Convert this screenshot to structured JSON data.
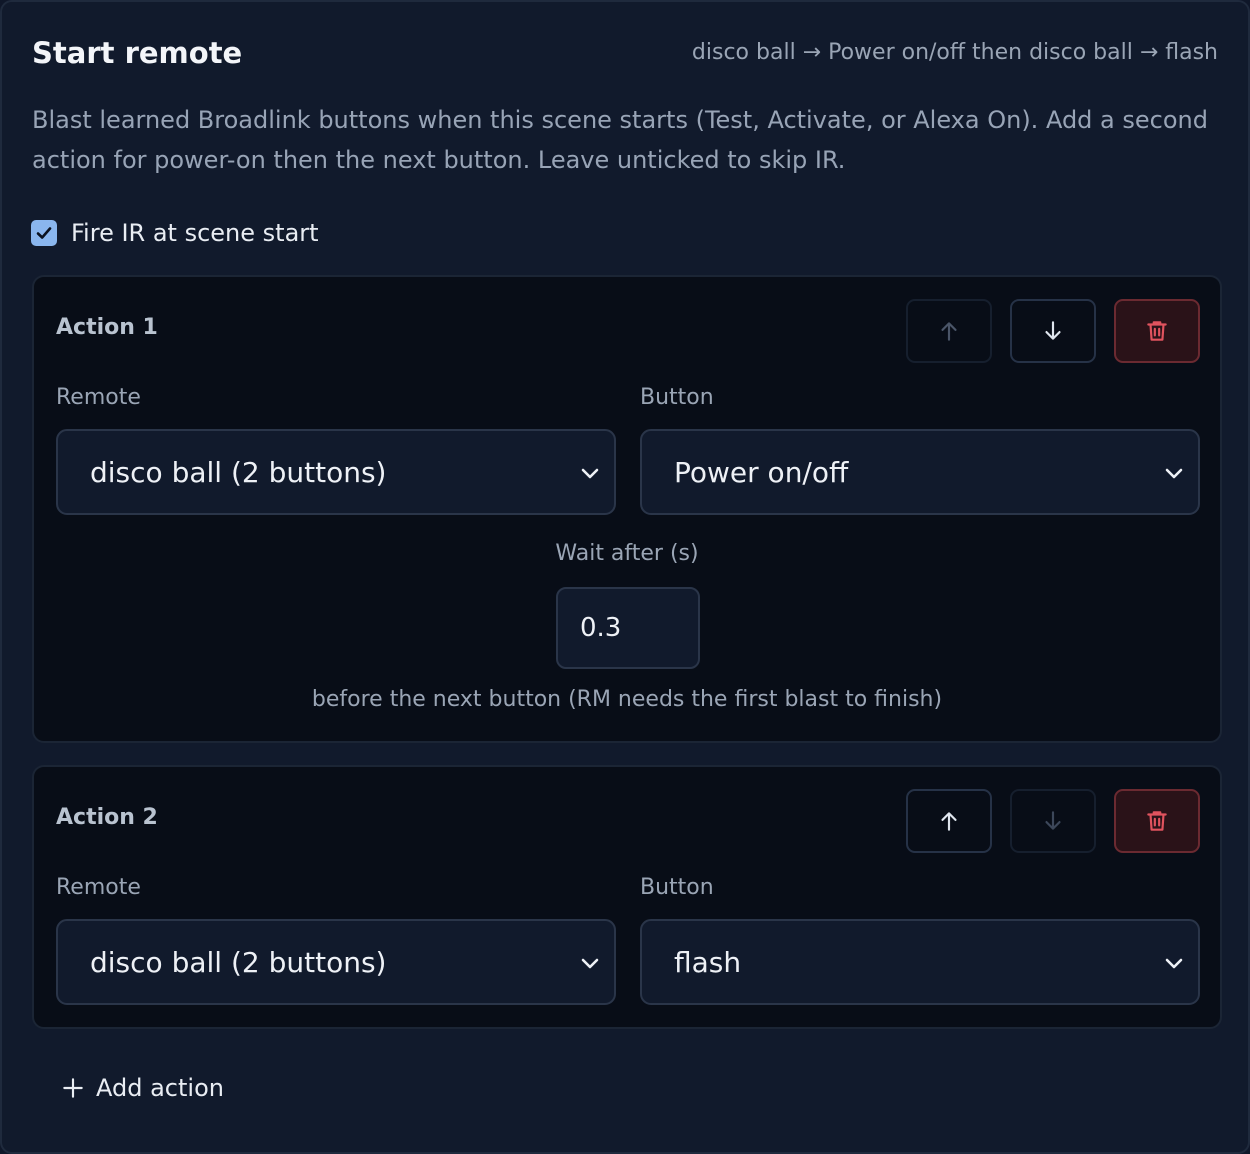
{
  "header": {
    "title": "Start remote",
    "summary": "disco ball → Power on/off then disco ball → flash"
  },
  "description": "Blast learned Broadlink buttons when this scene starts (Test, Activate, or Alexa On). Add a second action for power-on then the next button. Leave unticked to skip IR.",
  "fire_ir": {
    "label": "Fire IR at scene start",
    "checked": true
  },
  "actions": [
    {
      "title": "Action 1",
      "remote_label": "Remote",
      "remote_value": "disco ball (2 buttons)",
      "button_label": "Button",
      "button_value": "Power on/off",
      "wait_label": "Wait after (s)",
      "wait_value": "0.3",
      "wait_note": "before the next button (RM needs the first blast to finish)"
    },
    {
      "title": "Action 2",
      "remote_label": "Remote",
      "remote_value": "disco ball (2 buttons)",
      "button_label": "Button",
      "button_value": "flash"
    }
  ],
  "add_action_label": "Add action",
  "icons": {
    "up": "arrow-up-icon",
    "down": "arrow-down-icon",
    "delete": "trash-icon",
    "chevron": "chevron-down-icon",
    "add": "plus-icon",
    "check": "check-icon"
  },
  "colors": {
    "accent": "#8ab6ee",
    "danger": "#e0535e",
    "danger_bg": "#2a1218"
  }
}
